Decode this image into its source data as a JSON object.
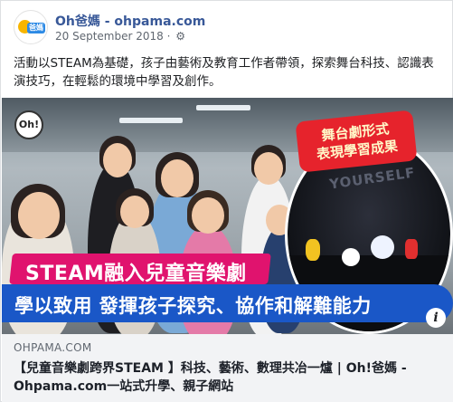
{
  "post": {
    "page_name": "Oh爸媽 - ohpama.com",
    "date": "20 September 2018 · ",
    "privacy_icon": "gear-icon",
    "body": "活動以STEAM為基礎，孩子由藝術及教育工作者帶領，探索舞台科技、認識表演技巧，在輕鬆的環境中學習及創作。",
    "avatar_text": "爸媽"
  },
  "image": {
    "logo_text": "Oh!",
    "bubble_text_line1": "舞台劇形式",
    "bubble_text_line2": "表現學習成果",
    "banner_primary": "STEAM融入兒童音樂劇",
    "banner_secondary": "學以致用 發揮孩子探究、協作和解難能力",
    "stage_word": "YOURSELF",
    "colors": {
      "pink_band": "#e0136e",
      "blue_band": "#1a57c7",
      "bubble_red": "#e6232c"
    }
  },
  "link": {
    "domain": "OHPAMA.COM",
    "title": "【兒童音樂劇跨界STEAM 】科技、藝術、數理共冶一爐 | Oh!爸媽 - Ohpama.com一站式升學、親子網站",
    "info_label": "i"
  }
}
